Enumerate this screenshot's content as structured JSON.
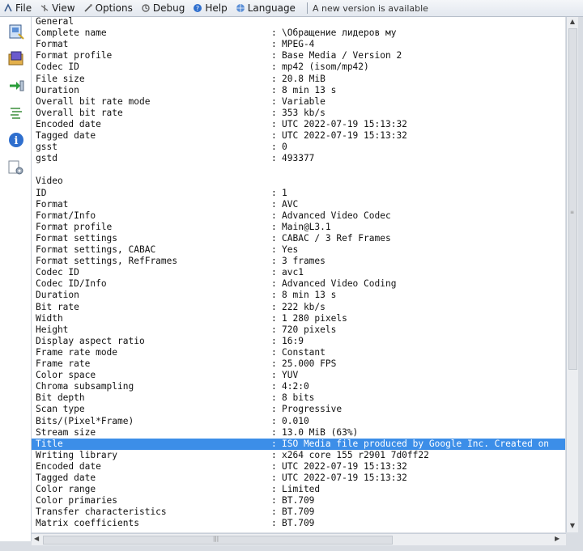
{
  "menu": {
    "file": "File",
    "view": "View",
    "options": "Options",
    "debug": "Debug",
    "help": "Help",
    "language": "Language",
    "notice": "A new version is available"
  },
  "general_title": "General",
  "general": [
    {
      "k": "Complete name",
      "v": "\\Обращение лидеров му"
    },
    {
      "k": "Format",
      "v": "MPEG-4"
    },
    {
      "k": "Format profile",
      "v": "Base Media / Version 2"
    },
    {
      "k": "Codec ID",
      "v": "mp42 (isom/mp42)"
    },
    {
      "k": "File size",
      "v": "20.8 MiB"
    },
    {
      "k": "Duration",
      "v": "8 min 13 s"
    },
    {
      "k": "Overall bit rate mode",
      "v": "Variable"
    },
    {
      "k": "Overall bit rate",
      "v": "353 kb/s"
    },
    {
      "k": "Encoded date",
      "v": "UTC 2022-07-19 15:13:32"
    },
    {
      "k": "Tagged date",
      "v": "UTC 2022-07-19 15:13:32"
    },
    {
      "k": "gsst",
      "v": "0"
    },
    {
      "k": "gstd",
      "v": "493377"
    }
  ],
  "video_title": "Video",
  "video": [
    {
      "k": "ID",
      "v": "1"
    },
    {
      "k": "Format",
      "v": "AVC"
    },
    {
      "k": "Format/Info",
      "v": "Advanced Video Codec"
    },
    {
      "k": "Format profile",
      "v": "Main@L3.1"
    },
    {
      "k": "Format settings",
      "v": "CABAC / 3 Ref Frames"
    },
    {
      "k": "Format settings, CABAC",
      "v": "Yes"
    },
    {
      "k": "Format settings, RefFrames",
      "v": "3 frames"
    },
    {
      "k": "Codec ID",
      "v": "avc1"
    },
    {
      "k": "Codec ID/Info",
      "v": "Advanced Video Coding"
    },
    {
      "k": "Duration",
      "v": "8 min 13 s"
    },
    {
      "k": "Bit rate",
      "v": "222 kb/s"
    },
    {
      "k": "Width",
      "v": "1 280 pixels"
    },
    {
      "k": "Height",
      "v": "720 pixels"
    },
    {
      "k": "Display aspect ratio",
      "v": "16:9"
    },
    {
      "k": "Frame rate mode",
      "v": "Constant"
    },
    {
      "k": "Frame rate",
      "v": "25.000 FPS"
    },
    {
      "k": "Color space",
      "v": "YUV"
    },
    {
      "k": "Chroma subsampling",
      "v": "4:2:0"
    },
    {
      "k": "Bit depth",
      "v": "8 bits"
    },
    {
      "k": "Scan type",
      "v": "Progressive"
    },
    {
      "k": "Bits/(Pixel*Frame)",
      "v": "0.010"
    },
    {
      "k": "Stream size",
      "v": "13.0 MiB (63%)"
    },
    {
      "k": "Title",
      "v": "ISO Media file produced by Google Inc. Created on",
      "selected": true
    },
    {
      "k": "Writing library",
      "v": "x264 core 155 r2901 7d0ff22"
    },
    {
      "k": "Encoded date",
      "v": "UTC 2022-07-19 15:13:32"
    },
    {
      "k": "Tagged date",
      "v": "UTC 2022-07-19 15:13:32"
    },
    {
      "k": "Color range",
      "v": "Limited"
    },
    {
      "k": "Color primaries",
      "v": "BT.709"
    },
    {
      "k": "Transfer characteristics",
      "v": "BT.709"
    },
    {
      "k": "Matrix coefficients",
      "v": "BT.709"
    }
  ],
  "colon": ":",
  "colors": {
    "selection": "#3c8ee8",
    "menubar": "#e3e8ef"
  },
  "icons": [
    "file-icon",
    "view-icon",
    "options-icon",
    "debug-icon",
    "help-icon",
    "language-icon"
  ]
}
